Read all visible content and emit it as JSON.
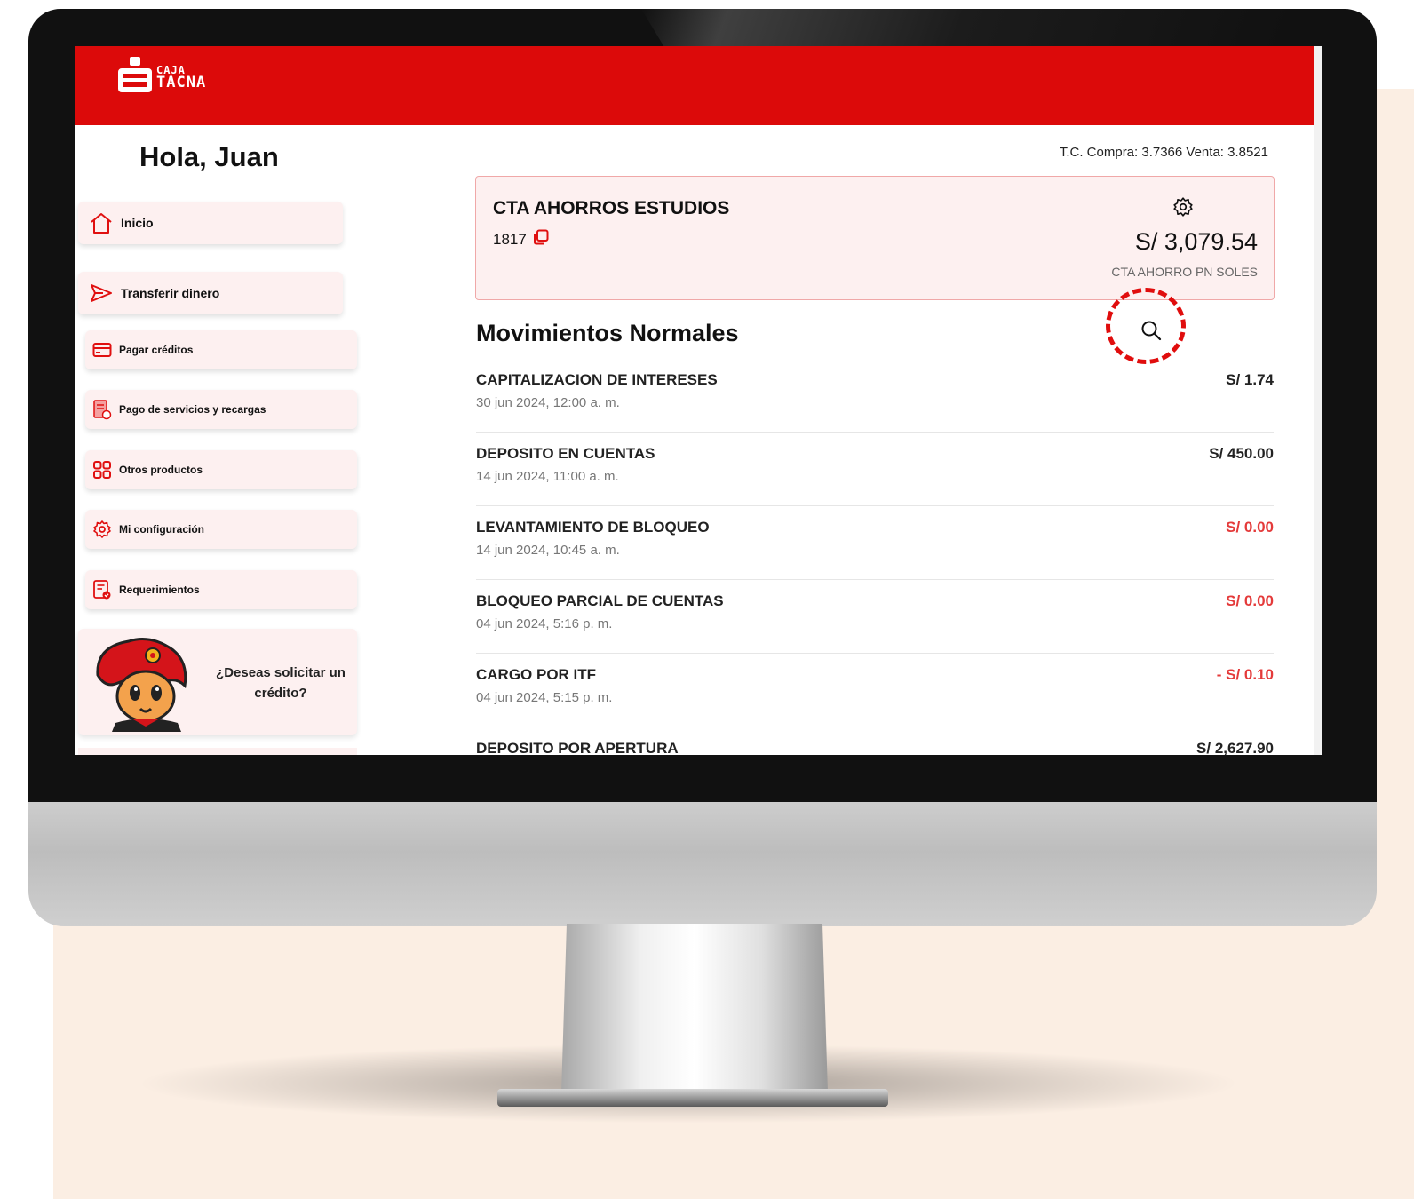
{
  "brand": {
    "logo_line1": "CAJA",
    "logo_line2": "TACNA",
    "accent": "#dc0a0a"
  },
  "greeting": "Hola, Juan",
  "sidebar": {
    "items": [
      {
        "label": "Inicio",
        "icon": "home-icon"
      },
      {
        "label": "Transferir dinero",
        "icon": "send-icon"
      },
      {
        "label": "Pagar créditos",
        "icon": "credit-card-icon"
      },
      {
        "label": "Pago de servicios y recargas",
        "icon": "bill-icon"
      },
      {
        "label": "Otros productos",
        "icon": "grid-icon"
      },
      {
        "label": "Mi configuración",
        "icon": "gear-icon"
      },
      {
        "label": "Requerimientos",
        "icon": "document-icon"
      }
    ],
    "promo_text": "¿Deseas solicitar un crédito?"
  },
  "exchange_rate": "T.C. Compra: 3.7366 Venta: 3.8521",
  "account": {
    "name": "CTA AHORROS ESTUDIOS",
    "number": "1817",
    "balance": "S/ 3,079.54",
    "type": "CTA AHORRO PN SOLES"
  },
  "movements": {
    "title": "Movimientos Normales",
    "items": [
      {
        "title": "CAPITALIZACION DE INTERESES",
        "date": "30 jun 2024, 12:00 a. m.",
        "amount": "S/ 1.74",
        "negative": false
      },
      {
        "title": "DEPOSITO EN CUENTAS",
        "date": "14 jun 2024, 11:00 a. m.",
        "amount": "S/ 450.00",
        "negative": false
      },
      {
        "title": "LEVANTAMIENTO DE BLOQUEO",
        "date": "14 jun 2024, 10:45 a. m.",
        "amount": "S/ 0.00",
        "negative": true
      },
      {
        "title": "BLOQUEO PARCIAL DE CUENTAS",
        "date": "04 jun 2024, 5:16 p. m.",
        "amount": "S/ 0.00",
        "negative": true
      },
      {
        "title": "CARGO POR ITF",
        "date": "04 jun 2024, 5:15 p. m.",
        "amount": "- S/ 0.10",
        "negative": true
      },
      {
        "title": "DEPOSITO POR APERTURA",
        "date": "",
        "amount": "S/ 2,627.90",
        "negative": false
      }
    ]
  }
}
